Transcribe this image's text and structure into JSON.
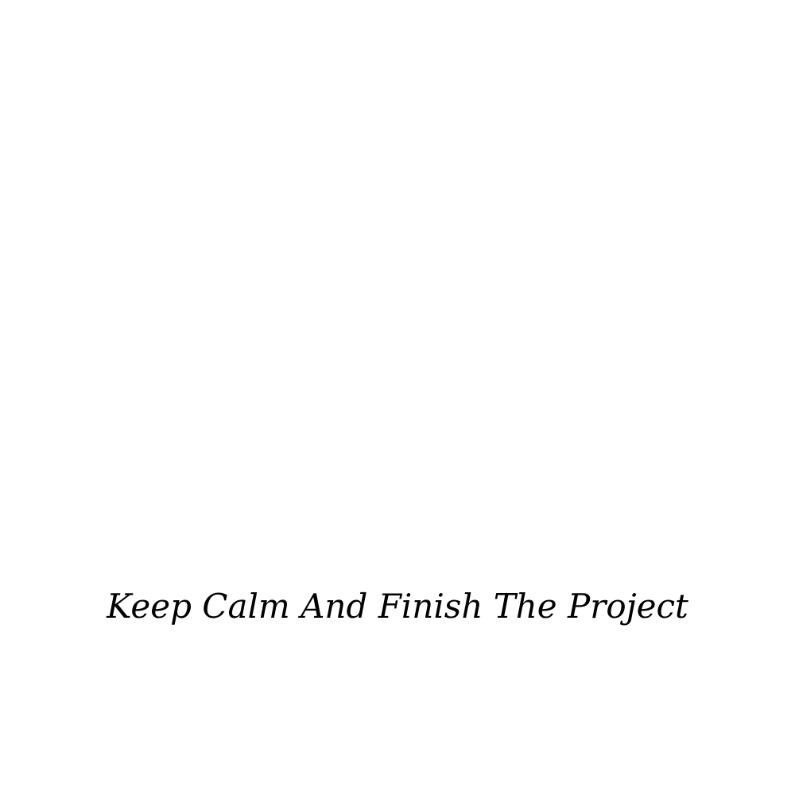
{
  "caption": {
    "text": "Keep Calm And Finish The Project"
  },
  "colors": {
    "background": "#ffffff",
    "text": "#000000"
  }
}
